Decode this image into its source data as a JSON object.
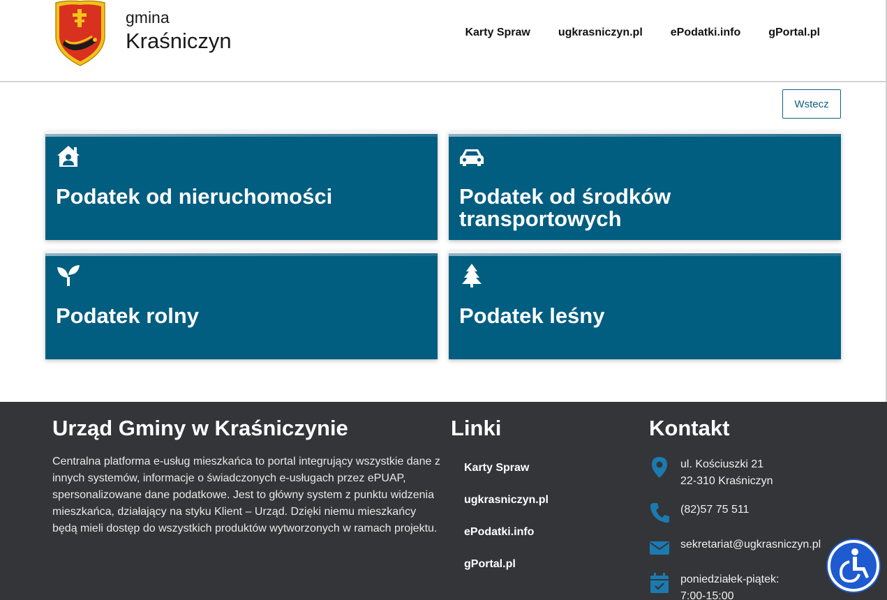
{
  "header": {
    "brand_small": "gmina",
    "brand_big": "Kraśniczyn",
    "nav": [
      "Karty Spraw",
      "ugkrasniczyn.pl",
      "ePodatki.info",
      "gPortal.pl"
    ]
  },
  "back_button": "Wstecz",
  "tiles": [
    {
      "title": "Podatek od nieruchomości",
      "icon": "house-user-icon"
    },
    {
      "title_line1": "Podatek od środków",
      "title_line2": "transportowych",
      "icon": "car-icon"
    },
    {
      "title": "Podatek rolny",
      "icon": "seedling-icon"
    },
    {
      "title": "Podatek leśny",
      "icon": "tree-icon"
    }
  ],
  "footer": {
    "about_heading": "Urząd Gminy w Kraśniczynie",
    "about_text": "Centralna platforma e-usług mieszkańca to portal integrujący wszystkie dane z innych systemów, informacje o świadczonych e-usługach przez ePUAP, spersonalizowane dane podatkowe. Jest to główny system z punktu widzenia mieszkańca, działający na styku Klient – Urząd. Dzięki niemu mieszkańcy będą mieli dostęp do wszystkich produktów wytworzonych w ramach projektu.",
    "links_heading": "Linki",
    "links": [
      "Karty Spraw",
      "ugkrasniczyn.pl",
      "ePodatki.info",
      "gPortal.pl"
    ],
    "contact_heading": "Kontakt",
    "address_line1": "ul. Kościuszki 21",
    "address_line2": "22-310 Kraśniczyn",
    "phone": "(82)57 75 511",
    "email": "sekretariat@ugkrasniczyn.pl",
    "hours_days": "poniedziałek-piątek:",
    "hours_time": "7:00-15:00"
  },
  "colors": {
    "tile_bg": "#025e80",
    "footer_bg": "#343538",
    "accent": "#0e5e80",
    "contact_icon": "#1b7bb0",
    "a11y_bg": "#1f5bd0"
  }
}
